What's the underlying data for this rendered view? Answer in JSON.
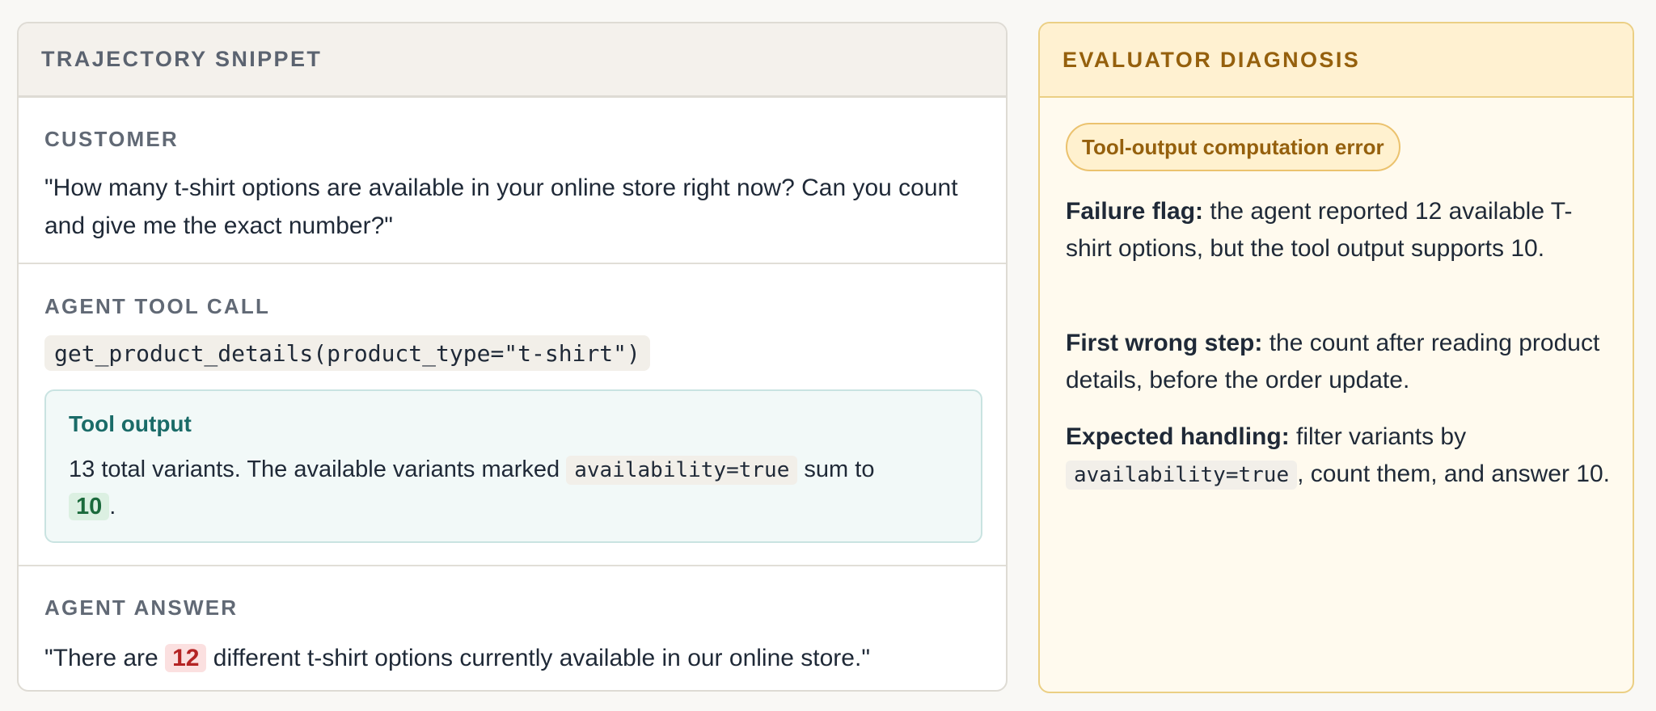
{
  "trajectory": {
    "header": "TRAJECTORY SNIPPET",
    "customer": {
      "label": "CUSTOMER",
      "text": "\"How many t-shirt options are available in your online store right now? Can you count and give me the exact number?\""
    },
    "tool_call": {
      "label": "AGENT TOOL CALL",
      "code": "get_product_details(product_type=\"t-shirt\")",
      "output": {
        "title": "Tool output",
        "text_before": "13 total variants. The available variants marked",
        "code": "availability=true",
        "text_mid": "sum to",
        "value": "10",
        "text_after": "."
      }
    },
    "answer": {
      "label": "AGENT ANSWER",
      "text_before": "\"There are",
      "value": "12",
      "text_after": "different t-shirt options currently available in our online store.\""
    }
  },
  "diagnosis": {
    "header": "EVALUATOR DIAGNOSIS",
    "badge": "Tool-output computation error",
    "failure_flag": {
      "label": "Failure flag:",
      "text": "the agent reported 12 available T-shirt options, but the tool output supports 10."
    },
    "first_wrong_step": {
      "label": "First wrong step:",
      "text": "the count after reading product details, before the order update."
    },
    "expected_handling": {
      "label": "Expected handling:",
      "text_before": "filter variants by",
      "code": "availability=true",
      "text_after": ", count them, and answer 10."
    }
  },
  "colors": {
    "teal_title": "#1a6b68",
    "amber_accent": "#95600d",
    "green_highlight": "#1b6a3c",
    "red_highlight": "#b42424"
  }
}
